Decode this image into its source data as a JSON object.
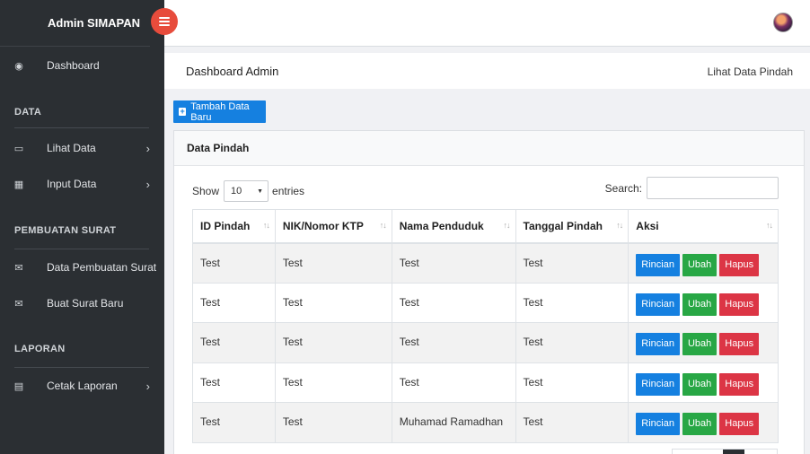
{
  "sidebar": {
    "brand": "Admin SIMAPAN",
    "dashboard": {
      "label": "Dashboard",
      "icon": "dashboard-icon"
    },
    "section_data": "DATA",
    "lihat_data": {
      "label": "Lihat Data",
      "icon": "laptop-icon"
    },
    "input_data": {
      "label": "Input Data",
      "icon": "table-icon"
    },
    "section_surat": "PEMBUATAN SURAT",
    "data_pembuatan_surat": {
      "label": "Data Pembuatan Surat",
      "icon": "envelope-icon"
    },
    "buat_surat_baru": {
      "label": "Buat Surat Baru",
      "icon": "envelope-icon"
    },
    "section_laporan": "LAPORAN",
    "cetak_laporan": {
      "label": "Cetak Laporan",
      "icon": "file-icon"
    }
  },
  "header": {
    "title": "Dashboard Admin",
    "crumb": "Lihat Data Pindah"
  },
  "actions": {
    "add_label": "Tambah Data Baru"
  },
  "card": {
    "title": "Data Pindah",
    "show_label": "Show",
    "entries_value": "10",
    "entries_label": "entries",
    "search_label": "Search:"
  },
  "table": {
    "columns": [
      "ID Pindah",
      "NIK/Nomor KTP",
      "Nama Penduduk",
      "Tanggal Pindah",
      "Aksi"
    ],
    "rows": [
      [
        "Test",
        "Test",
        "Test",
        "Test"
      ],
      [
        "Test",
        "Test",
        "Test",
        "Test"
      ],
      [
        "Test",
        "Test",
        "Test",
        "Test"
      ],
      [
        "Test",
        "Test",
        "Test",
        "Test"
      ],
      [
        "Test",
        "Test",
        "Muhamad Ramadhan",
        "Test"
      ]
    ],
    "btn_detail": "Rincian",
    "btn_edit": "Ubah",
    "btn_delete": "Hapus"
  },
  "colors": {
    "sidebar_bg": "#2b2f33",
    "primary": "#1580e0",
    "success": "#28a745",
    "danger": "#dc3545",
    "toggle": "#e74c3c"
  }
}
